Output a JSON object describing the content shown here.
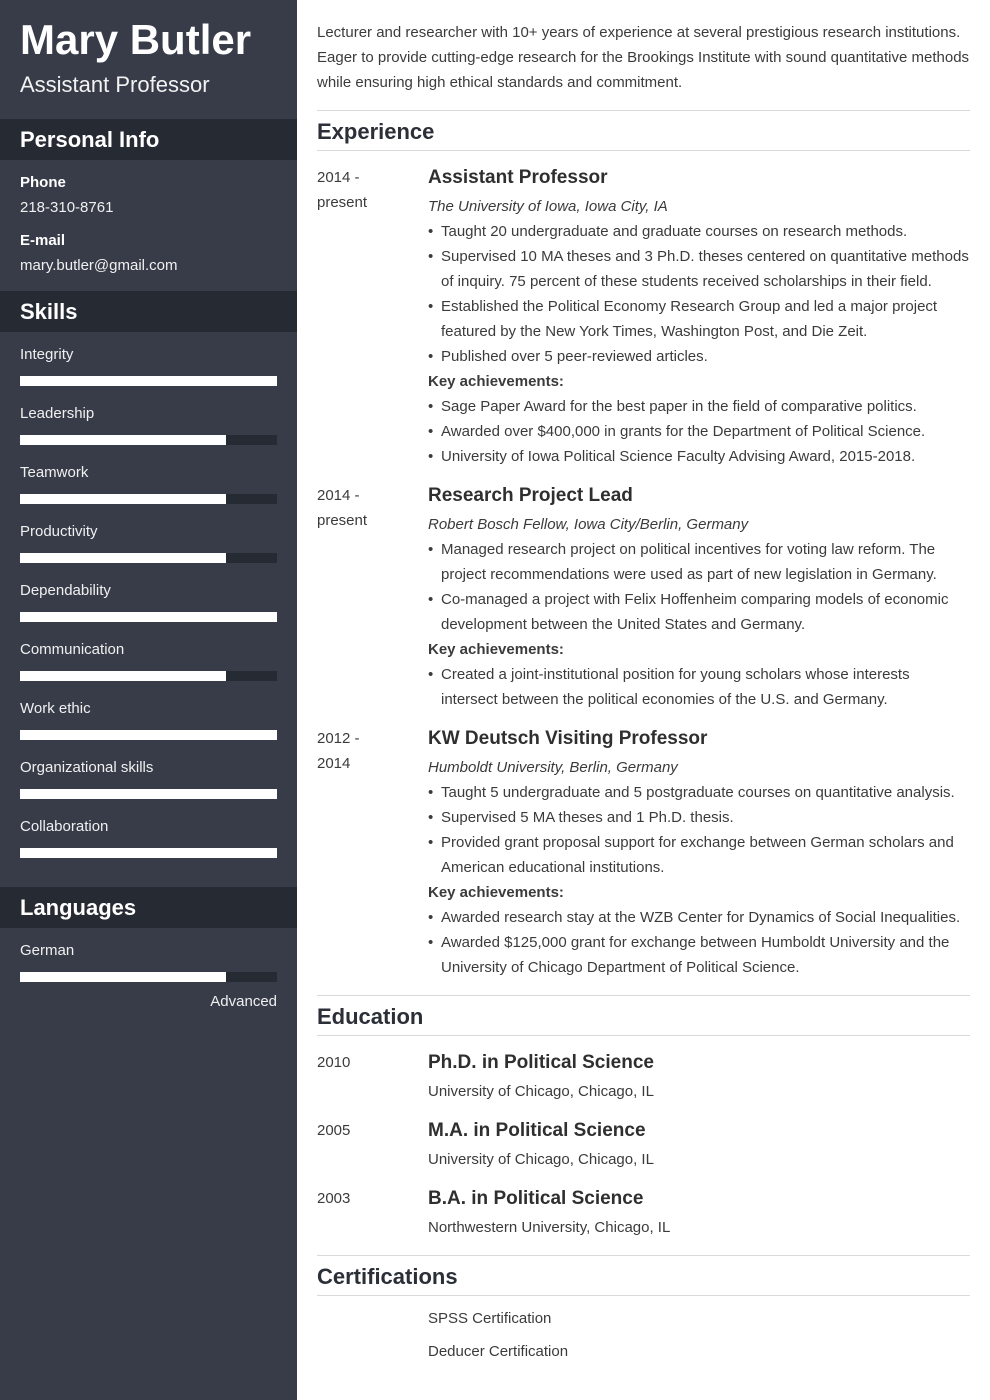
{
  "sidebar": {
    "name": "Mary Butler",
    "title": "Assistant Professor",
    "personal_info": {
      "heading": "Personal Info",
      "phone_label": "Phone",
      "phone": "218-310-8761",
      "email_label": "E-mail",
      "email": "mary.butler@gmail.com"
    },
    "skills": {
      "heading": "Skills",
      "items": [
        {
          "name": "Integrity",
          "level": 100
        },
        {
          "name": "Leadership",
          "level": 80
        },
        {
          "name": "Teamwork",
          "level": 80
        },
        {
          "name": "Productivity",
          "level": 80
        },
        {
          "name": "Dependability",
          "level": 100
        },
        {
          "name": "Communication",
          "level": 80
        },
        {
          "name": "Work ethic",
          "level": 100
        },
        {
          "name": "Organizational skills",
          "level": 100
        },
        {
          "name": "Collaboration",
          "level": 100
        }
      ]
    },
    "languages": {
      "heading": "Languages",
      "items": [
        {
          "name": "German",
          "level": 80,
          "level_label": "Advanced"
        }
      ]
    }
  },
  "main": {
    "summary": "Lecturer and researcher with 10+ years of experience at several prestigious research institutions. Eager to provide cutting-edge research for the Brookings Institute with sound quantitative methods while ensuring high ethical standards and commitment.",
    "experience": {
      "heading": "Experience",
      "key_label": "Key achievements:",
      "entries": [
        {
          "date_start": "2014 -",
          "date_end": "present",
          "title": "Assistant Professor",
          "org": "The University of Iowa, Iowa City, IA",
          "bullets": [
            "Taught 20 undergraduate and graduate courses on research methods.",
            "Supervised 10 MA theses and 3 Ph.D. theses centered on quantitative methods of inquiry. 75 percent of these students received scholarships in their field.",
            "Established the Political Economy Research Group and led a major project featured by the New York Times, Washington Post, and Die Zeit.",
            "Published over 5 peer-reviewed articles."
          ],
          "achievements": [
            "Sage Paper Award for the best paper in the field of comparative politics.",
            "Awarded over $400,000 in grants for the Department of Political Science.",
            "University of Iowa Political Science Faculty Advising Award, 2015-2018."
          ]
        },
        {
          "date_start": "2014 -",
          "date_end": "present",
          "title": "Research Project Lead",
          "org": "Robert Bosch Fellow, Iowa City/Berlin, Germany",
          "bullets": [
            "Managed research project on political incentives for voting law reform. The project recommendations were used as part of new legislation in Germany.",
            "Co-managed a project with Felix Hoffenheim comparing models of economic development between the United States and Germany."
          ],
          "achievements": [
            "Created a joint-institutional position for young scholars whose interests intersect between the political economies of the U.S. and Germany."
          ]
        },
        {
          "date_start": "2012 -",
          "date_end": "2014",
          "title": "KW Deutsch Visiting Professor",
          "org": "Humboldt University, Berlin, Germany",
          "bullets": [
            "Taught 5 undergraduate and 5 postgraduate courses on quantitative analysis.",
            "Supervised 5 MA theses and 1 Ph.D. thesis.",
            "Provided grant proposal support for exchange between German scholars and American educational institutions."
          ],
          "achievements": [
            "Awarded research stay at the WZB Center for Dynamics of Social Inequalities.",
            "Awarded $125,000 grant for exchange between Humboldt University and the University of Chicago Department of Political Science."
          ]
        }
      ]
    },
    "education": {
      "heading": "Education",
      "entries": [
        {
          "year": "2010",
          "degree": "Ph.D. in Political Science",
          "school": "University of Chicago, Chicago, IL"
        },
        {
          "year": "2005",
          "degree": "M.A. in Political Science",
          "school": "University of Chicago, Chicago, IL"
        },
        {
          "year": "2003",
          "degree": "B.A. in Political Science",
          "school": "Northwestern University, Chicago, IL"
        }
      ]
    },
    "certifications": {
      "heading": "Certifications",
      "items": [
        "SPSS Certification",
        "Deducer Certification"
      ]
    }
  },
  "colors": {
    "sidebar_bg": "#373c48",
    "sidebar_band": "#262a33",
    "bar_fill": "#ffffff",
    "heading_text": "#2b2f37",
    "body_text": "#3b3b3b",
    "divider": "#d9d9d9"
  }
}
